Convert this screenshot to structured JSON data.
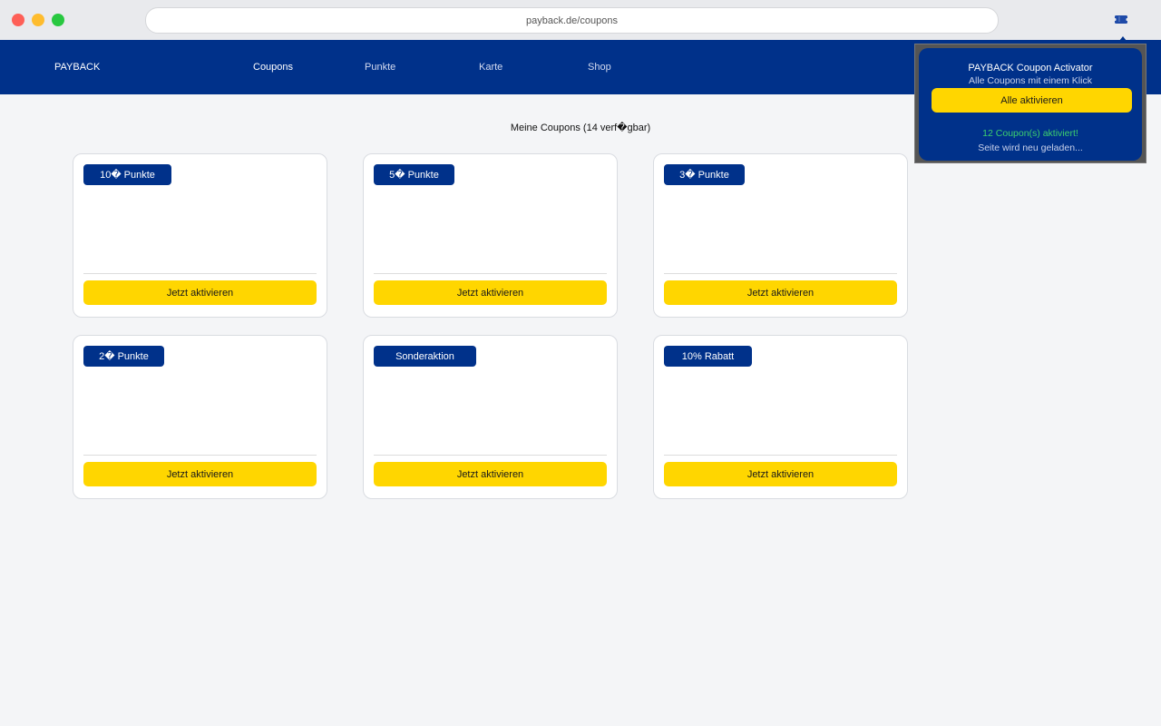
{
  "browser": {
    "url": "payback.de/coupons",
    "extension_icon": "ticket-icon"
  },
  "nav": {
    "brand": "PAYBACK",
    "links": [
      "Coupons",
      "Punkte",
      "Karte",
      "Shop"
    ]
  },
  "main": {
    "title": "Meine Coupons (14 verf�gbar)"
  },
  "coupons": [
    {
      "badge": "10� Punkte",
      "button": "Jetzt aktivieren"
    },
    {
      "badge": "5� Punkte",
      "button": "Jetzt aktivieren"
    },
    {
      "badge": "3� Punkte",
      "button": "Jetzt aktivieren"
    },
    {
      "badge": "2� Punkte",
      "button": "Jetzt aktivieren"
    },
    {
      "badge": "Sonderaktion",
      "button": "Jetzt aktivieren"
    },
    {
      "badge": "10% Rabatt",
      "button": "Jetzt aktivieren"
    }
  ],
  "popup": {
    "title": "PAYBACK Coupon Activator",
    "subtitle": "Alle Coupons mit einem Klick",
    "button": "Alle aktivieren",
    "status": "12 Coupon(s) aktiviert!",
    "reload": "Seite wird neu geladen..."
  },
  "colors": {
    "brand_blue": "#00318a",
    "accent_yellow": "#ffd600",
    "success_green": "#3ccf6e"
  }
}
